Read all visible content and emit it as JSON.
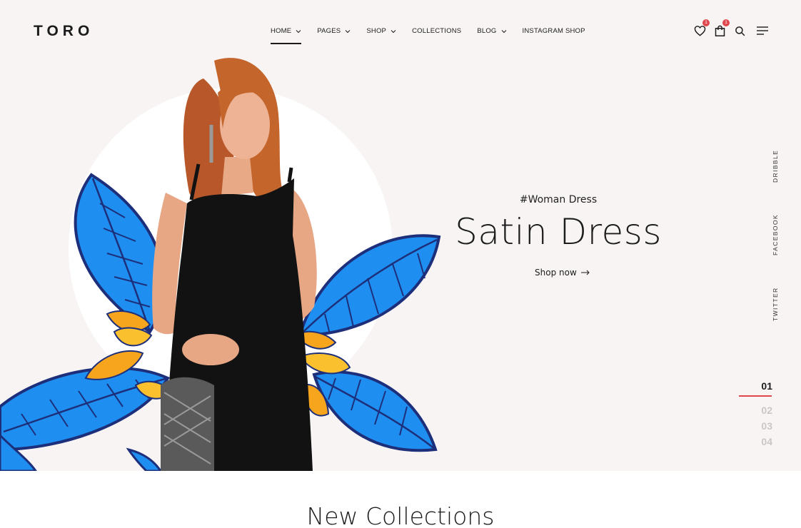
{
  "brand": {
    "logo": "TORO"
  },
  "nav": {
    "items": [
      {
        "label": "HOME",
        "has_dropdown": true,
        "active": true
      },
      {
        "label": "PAGES",
        "has_dropdown": true,
        "active": false
      },
      {
        "label": "SHOP",
        "has_dropdown": true,
        "active": false
      },
      {
        "label": "COLLECTIONS",
        "has_dropdown": false,
        "active": false
      },
      {
        "label": "BLOG",
        "has_dropdown": true,
        "active": false
      },
      {
        "label": "INSTAGRAM SHOP",
        "has_dropdown": false,
        "active": false
      }
    ]
  },
  "header_icons": {
    "wishlist": {
      "icon": "heart-icon",
      "count": "1"
    },
    "cart": {
      "icon": "shopping-bag-icon",
      "count": "1"
    },
    "search": {
      "icon": "search-icon"
    },
    "menu": {
      "icon": "hamburger-menu-icon"
    }
  },
  "hero": {
    "tagline": "#Woman Dress",
    "headline": "Satin Dress",
    "cta_label": "Shop now",
    "background_color": "#f8f4f4"
  },
  "social": [
    "DRIBBLE",
    "FACEBOOK",
    "TWITTER"
  ],
  "slides": {
    "items": [
      "01",
      "02",
      "03",
      "04"
    ],
    "active_index": 0,
    "accent_color": "#e0474c"
  },
  "section": {
    "title": "New Collections"
  },
  "colors": {
    "accent": "#e0474c",
    "leaf_blue": "#1e8ff0",
    "leaf_outline": "#1d2f7a",
    "flower_yellow": "#f7a51c"
  }
}
